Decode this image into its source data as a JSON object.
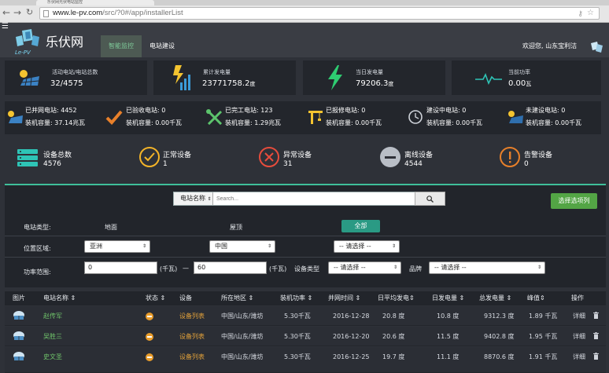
{
  "browser": {
    "tab_title": "乐伏网光伏电站监控",
    "url_host": "www.le-pv.com",
    "url_path": "/src/?0#/app/installerList"
  },
  "header": {
    "logo_text": "乐伏网",
    "logo_sub": "Le-PV",
    "nav": [
      {
        "label": "智能监控",
        "active": true
      },
      {
        "label": "电站建设",
        "active": false
      }
    ],
    "welcome": "欢迎您, 山东宝利洁"
  },
  "stats": [
    {
      "label": "活动电站/电站总数",
      "value": "32/4575",
      "icon": "solar-panel-icon"
    },
    {
      "label": "累计发电量",
      "value": "23771758.2",
      "unit": "度",
      "icon": "energy-bars-icon"
    },
    {
      "label": "当日发电量",
      "value": "79206.3",
      "unit": "度",
      "icon": "lightning-icon"
    },
    {
      "label": "当前功率",
      "value": "0.00",
      "unit": "瓦",
      "icon": "pulse-icon"
    }
  ],
  "station_status": [
    {
      "name": "已并网电站:",
      "count": "4452",
      "cap_label": "装机容量:",
      "cap": "37.14兆瓦",
      "icon": "grid-connected-icon"
    },
    {
      "name": "已验收电站:",
      "count": "0",
      "cap_label": "装机容量:",
      "cap": "0.00千瓦",
      "icon": "checkmark-icon"
    },
    {
      "name": "已完工电站:",
      "count": "123",
      "cap_label": "装机容量:",
      "cap": "1.29兆瓦",
      "icon": "tools-icon"
    },
    {
      "name": "已报修电站:",
      "count": "0",
      "cap_label": "装机容量:",
      "cap": "0.00千瓦",
      "icon": "crane-icon"
    },
    {
      "name": "建设中电站:",
      "count": "0",
      "cap_label": "装机容量:",
      "cap": "0.00千瓦",
      "icon": "clock-icon"
    },
    {
      "name": "未建设电站:",
      "count": "0",
      "cap_label": "装机容量:",
      "cap": "0.00千瓦",
      "icon": "solar-unbuilt-icon"
    }
  ],
  "devices": [
    {
      "name": "设备总数",
      "count": "4576",
      "icon": "server-icon"
    },
    {
      "name": "正常设备",
      "count": "1",
      "icon": "check-circle-icon"
    },
    {
      "name": "异常设备",
      "count": "31",
      "icon": "error-circle-icon"
    },
    {
      "name": "离线设备",
      "count": "4544",
      "icon": "offline-circle-icon"
    },
    {
      "name": "告警设备",
      "count": "0",
      "icon": "warning-circle-icon"
    }
  ],
  "search": {
    "type_label": "电站名称",
    "placeholder": "Search...",
    "choose_columns": "选择选项列"
  },
  "filters": {
    "station_type_label": "电站类型:",
    "station_type_options": [
      "地面",
      "屋顶",
      "全部"
    ],
    "region_label": "位置区域:",
    "region_values": [
      "亚洲",
      "中国",
      "-- 请选择 --"
    ],
    "power_label": "功率范围:",
    "power_min": "0",
    "power_max": "60",
    "unit_1": "(千瓦)",
    "dash": "—",
    "unit_2": "(千瓦)",
    "device_type_label": "设备类型",
    "device_type_value": "-- 请选择 --",
    "brand_label": "品牌",
    "brand_value": "-- 请选择 --"
  },
  "table": {
    "columns": [
      "图片",
      "电站名称 ⇕",
      "状态 ⇕",
      "设备",
      "所在地区 ⇕",
      "装机功率 ⇕",
      "并网时间 ⇕",
      "日平均发电⇕",
      "日发电量 ⇕",
      "总发电量 ⇕",
      "峰值⇕",
      "操作"
    ],
    "rows": [
      {
        "name": "赵传军",
        "device": "设备列表",
        "region": "中国/山东/潍坊",
        "power": "5.30千瓦",
        "date": "2016-12-28",
        "avg": "20.8 度",
        "daily": "10.8 度",
        "total": "9312.3 度",
        "peak": "1.89 千瓦",
        "action": "详细"
      },
      {
        "name": "吴胜三",
        "device": "设备列表",
        "region": "中国/山东/潍坊",
        "power": "5.30千瓦",
        "date": "2016-12-20",
        "avg": "20.6 度",
        "daily": "11.5 度",
        "total": "9402.8 度",
        "peak": "1.95 千瓦",
        "action": "详细"
      },
      {
        "name": "史文圣",
        "device": "设备列表",
        "region": "中国/山东/潍坊",
        "power": "5.30千瓦",
        "date": "2016-12-25",
        "avg": "19.7 度",
        "daily": "11.1 度",
        "total": "8870.6 度",
        "peak": "1.91 千瓦",
        "action": "详细"
      }
    ]
  },
  "colors": {
    "accent_green": "#53a545",
    "teal": "#3fbf9a",
    "orange": "#e3a23a",
    "lightning": "#2ecc71",
    "error_red": "#e74c3c"
  }
}
